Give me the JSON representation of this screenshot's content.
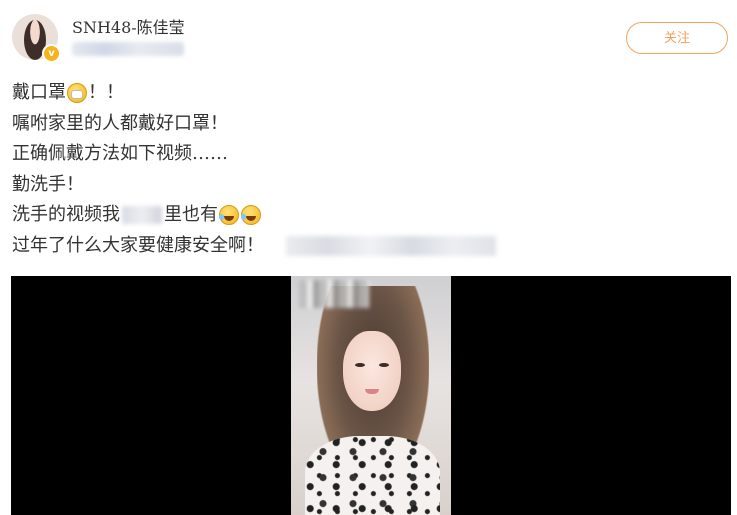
{
  "header": {
    "username": "SNH48-陈佳莹",
    "follow_label": "关注",
    "verified_badge": "v",
    "accent_color": "#f5a25d"
  },
  "post": {
    "lines": [
      {
        "a": "戴口罩",
        "b": "！！"
      },
      {
        "text": "嘱咐家里的人都戴好口罩！"
      },
      {
        "text": "正确佩戴方法如下视频……"
      },
      {
        "text": "勤洗手！"
      },
      {
        "a": "洗手的视频我",
        "b": "里也有"
      },
      {
        "text": "过年了什么大家要健康安全啊！"
      }
    ]
  },
  "video": {
    "background": "#000000"
  }
}
